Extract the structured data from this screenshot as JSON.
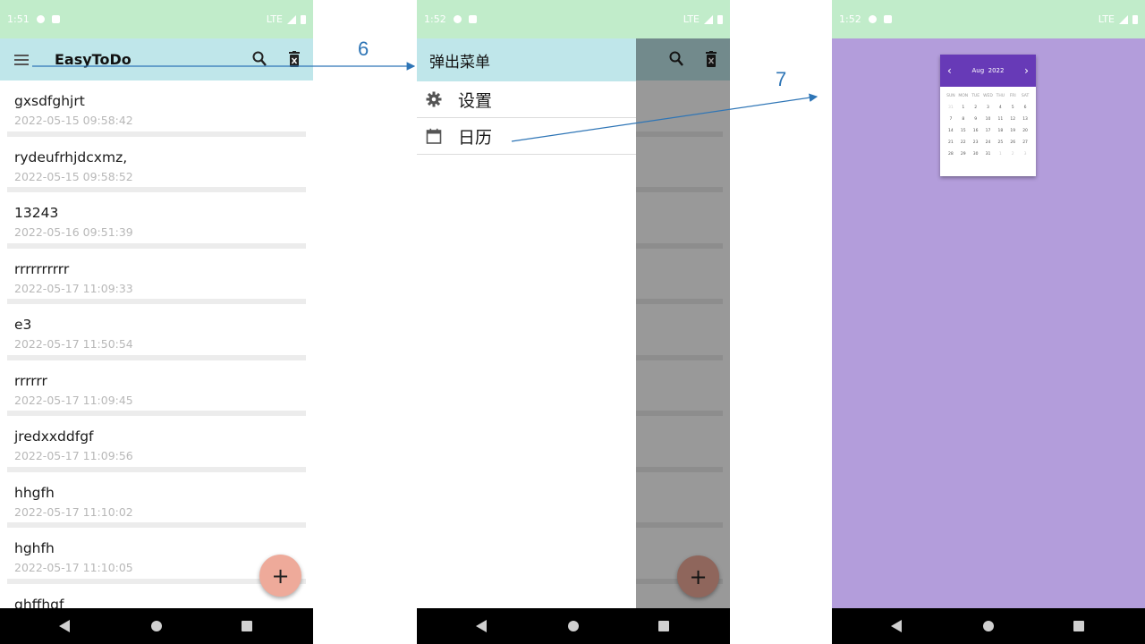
{
  "annotations": [
    "6",
    "7"
  ],
  "screen1": {
    "status_time": "1:51",
    "status_net": "LTE",
    "title": "EasyToDo",
    "items": [
      {
        "title": "gxsdfghjrt",
        "date": "2022-05-15 09:58:42"
      },
      {
        "title": "rydeufrhjdcxmz,",
        "date": "2022-05-15 09:58:52"
      },
      {
        "title": "13243",
        "date": "2022-05-16 09:51:39"
      },
      {
        "title": "rrrrrrrrrr",
        "date": "2022-05-17 11:09:33"
      },
      {
        "title": "e3",
        "date": "2022-05-17 11:50:54"
      },
      {
        "title": "rrrrrr",
        "date": "2022-05-17 11:09:45"
      },
      {
        "title": "jredxxddfgf",
        "date": "2022-05-17 11:09:56"
      },
      {
        "title": "hhgfh",
        "date": "2022-05-17 11:10:02"
      },
      {
        "title": "hghfh",
        "date": "2022-05-17 11:10:05"
      },
      {
        "title": "ghffhgf",
        "date": ""
      }
    ],
    "fab": "+"
  },
  "screen2": {
    "status_time": "1:52",
    "status_net": "LTE",
    "drawer_title": "弹出菜单",
    "settings_label": "设置",
    "calendar_label": "日历",
    "fab": "+"
  },
  "screen3": {
    "status_time": "1:52",
    "status_net": "LTE",
    "calendar": {
      "month": "Aug",
      "year": "2022",
      "prev": "‹",
      "next": "›",
      "weekdays": [
        "SUN",
        "MON",
        "TUE",
        "WED",
        "THU",
        "FRI",
        "SAT"
      ],
      "days": [
        "31",
        "1",
        "2",
        "3",
        "4",
        "5",
        "6",
        "7",
        "8",
        "9",
        "10",
        "11",
        "12",
        "13",
        "14",
        "15",
        "16",
        "17",
        "18",
        "19",
        "20",
        "21",
        "22",
        "23",
        "24",
        "25",
        "26",
        "27",
        "28",
        "29",
        "30",
        "31",
        "1",
        "2",
        "3"
      ]
    }
  },
  "colors": {
    "status_bar": "#c1ecca",
    "app_bar": "#bfe6ea",
    "fab": "#eeaa9a",
    "calendar_header": "#673ab7",
    "screen3_bg": "#b39ddb",
    "annotation": "#2e75b6"
  }
}
